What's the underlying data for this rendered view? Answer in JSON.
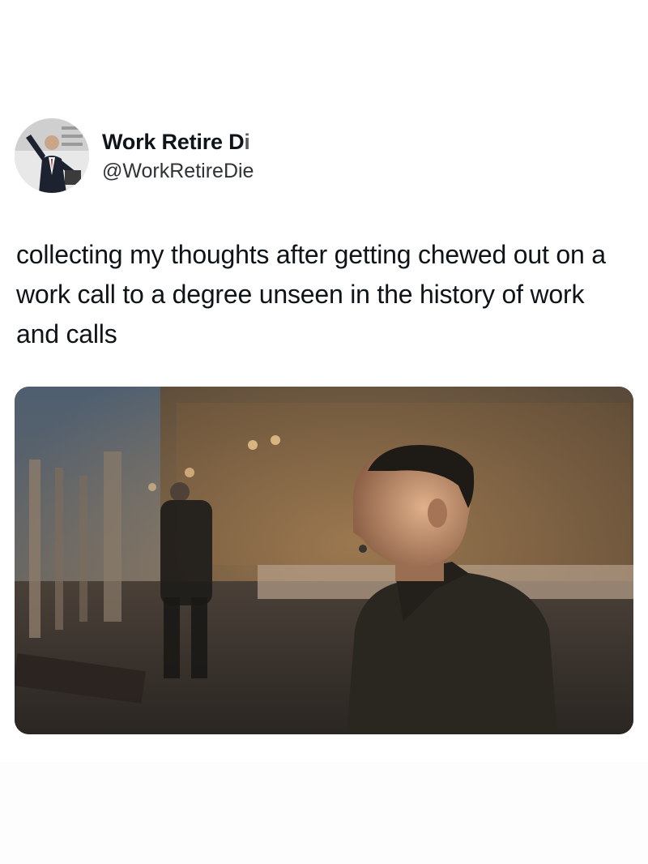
{
  "author": {
    "display_name": "Work Retire Di",
    "handle": "@WorkRetireDie",
    "avatar_icon": "profile-photo"
  },
  "tweet": {
    "text": "collecting my thoughts after getting chewed out on a work call to a degree unseen in the history of work and calls"
  },
  "media": {
    "type": "photo",
    "palette": {
      "sky": "#5a6a7a",
      "trees": "#5b4630",
      "ground": "#3a342e",
      "coat": "#2a2620",
      "skin": "#b88a6c",
      "hair": "#1e1a16"
    }
  }
}
